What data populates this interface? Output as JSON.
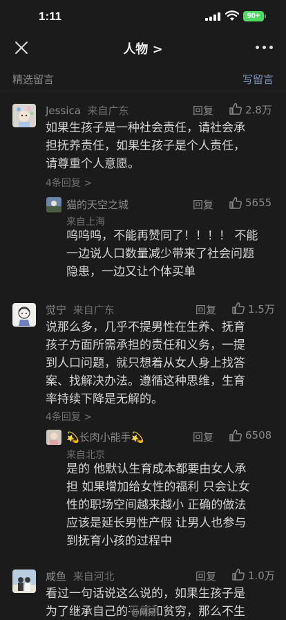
{
  "status": {
    "time": "1:11",
    "battery": "90+"
  },
  "nav": {
    "title": "人物 >"
  },
  "section": {
    "title": "精选留言",
    "write": "写留言"
  },
  "comments": [
    {
      "name": "Jessica",
      "location": "来自广东",
      "reply": "回复",
      "likes": "2.8万",
      "lines": [
        "如果生孩子是一种社会责任，请社会承",
        "担抚养责任，如果生孩子是个人责任，",
        "请尊重个人意愿。"
      ],
      "more": "4条回复 >",
      "sub": {
        "name": "猫的天空之城",
        "location": "来自上海",
        "reply": "回复",
        "likes": "5655",
        "lines": [
          "呜呜呜，不能再赞同了！！！！ 不能",
          "一边说人口数量减少带来了社会问题",
          "隐患，一边又让个体买单"
        ]
      }
    },
    {
      "name": "觉宁",
      "location": "来自广东",
      "reply": "回复",
      "likes": "1.5万",
      "lines": [
        "说那么多，几乎不提男性在生养、抚育",
        "孩子方面所需承担的责任和义务，一提",
        "到人口问题，就只想着从女人身上找答",
        "案、找解决办法。遵循这种思维，生育",
        "率持续下降是无解的。"
      ],
      "more": "4条回复 >",
      "sub": {
        "name": "💫长肉小能手💫",
        "location": "来自北京",
        "reply": "回复",
        "likes": "6508",
        "lines": [
          "是的 他默认生育成本都要由女人承",
          "担 如果增加给女性的福利 只会让女",
          "性的职场空间越来越小 正确的做法",
          "应该是延长男性产假 让男人也参与",
          "到抚育小孩的过程中"
        ]
      }
    },
    {
      "name": "咸鱼",
      "location": "来自河北",
      "reply": "回复",
      "likes": "1.0万",
      "lines": [
        "看过一句话说这么说的，如果生孩子是",
        "为了继承自己的平庸和贫穷，那么不生"
      ]
    }
  ],
  "watermark": "@网易"
}
